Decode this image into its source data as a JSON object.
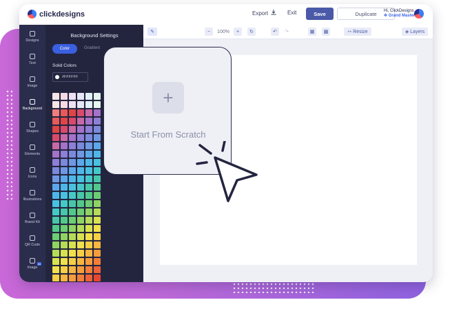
{
  "header": {
    "brand": "clickdesigns",
    "export_label": "Export",
    "exit_label": "Exit",
    "save_label": "Save",
    "duplicate_label": "Duplicate",
    "user_greeting": "Hi, ClickDesigns",
    "user_role": "Grand Master"
  },
  "sidebar": {
    "items": [
      {
        "label": "Designs"
      },
      {
        "label": "Text"
      },
      {
        "label": "Image"
      },
      {
        "label": "Background"
      },
      {
        "label": "Shapes"
      },
      {
        "label": "Elements"
      },
      {
        "label": "Icons"
      },
      {
        "label": "Illustrations"
      },
      {
        "label": "Brand Kit"
      },
      {
        "label": "QR Code"
      },
      {
        "label": "Image"
      }
    ],
    "ai_badge": "AI"
  },
  "background_panel": {
    "title": "Background Settings",
    "tab_color": "Color",
    "tab_gradient": "Gradient",
    "solid_label": "Solid Colors",
    "hex_value": "#FFFFFF"
  },
  "toolbar": {
    "zoom": "100%",
    "resize_label": "Resize",
    "layers_label": "Layers"
  },
  "overlay": {
    "start_label": "Start From Scratch"
  },
  "colors": {
    "accent": "#4a5aa8",
    "sidebar_bg": "#2b2d4c",
    "panel_bg": "#23253f"
  }
}
